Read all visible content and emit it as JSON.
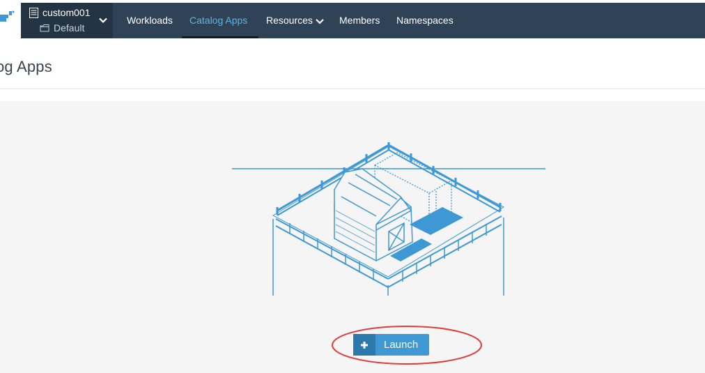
{
  "context": {
    "cluster": "custom001",
    "project": "Default",
    "cluster_icon": "cluster-icon",
    "project_icon": "folder-icon"
  },
  "nav": {
    "items": [
      {
        "label": "Workloads"
      },
      {
        "label": "Catalog Apps",
        "active": true
      },
      {
        "label": "Resources",
        "has_dropdown": true
      },
      {
        "label": "Members"
      },
      {
        "label": "Namespaces"
      }
    ]
  },
  "page": {
    "title": "og Apps"
  },
  "empty_state": {
    "launch_label": "Launch",
    "launch_icon": "plus-icon"
  },
  "colors": {
    "nav_bg": "#2f4256",
    "context_bg": "#243445",
    "active_nav": "#5fb6e0",
    "primary": "#3d98d3",
    "highlight": "#e03c3c",
    "illustration": "#3d98d3"
  }
}
